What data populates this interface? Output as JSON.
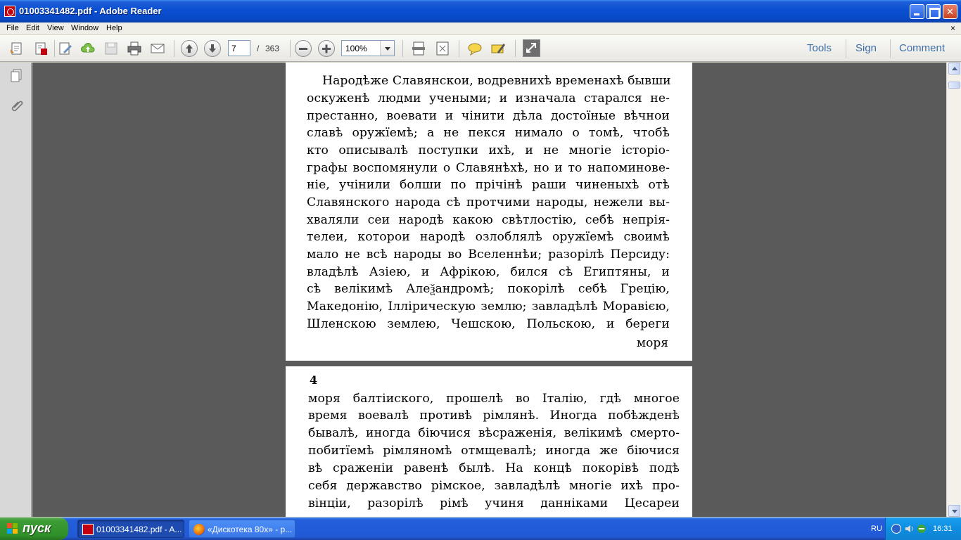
{
  "window": {
    "title": "01003341482.pdf - Adobe Reader"
  },
  "menu": {
    "items": [
      "File",
      "Edit",
      "View",
      "Window",
      "Help"
    ],
    "close_glyph": "×"
  },
  "toolbar": {
    "current_page": "7",
    "page_separator": "/",
    "total_pages": "363",
    "zoom": "100%",
    "right_links": [
      "Tools",
      "Sign",
      "Comment"
    ]
  },
  "document": {
    "page1_lines": [
      "Народѣже Славянскои, водревнихѣ временахѣ бывши",
      "оскуженѣ людми учеными; и изначала старался не-",
      "престанно, воевати и чінити дѣла достоїные вѣчнои",
      "славѣ оружїемѣ; а не пекся нимало о томѣ, чтобѣ",
      "кто описывалѣ поступки ихѣ, и не многіе історіо-",
      "графы воспомянули о Славянѣхѣ, но и то напоминове-",
      "ніе, учінили болши по прічінѣ раши чиненыхѣ отѣ",
      "Славянского народа сѣ протчими народы, нежели вы-",
      "хваляли сеи народѣ какою свѣтлостію, себѣ непрія-",
      "телеи, которои народѣ озлоблялѣ оружїемѣ своимѣ",
      "мало не всѣ народы во Вселеннѣи; разорілѣ Персиду:",
      "владѣлѣ Азіею, и Афрікою, бился сѣ Египтяны, и",
      "сѣ велікимѣ Алеѯандромѣ; покорілѣ себѣ Грецію,",
      "Македонію, Іллірическую землю; завладѣлѣ Моравією,",
      "Шленскою землею, Чешскою, Польскою, и береги"
    ],
    "page1_catchword": "моря",
    "page2_number": "4",
    "page2_lines": [
      "моря балтіиского, прошелѣ во Італію, гдѣ многое",
      "время воевалѣ противѣ рімлянѣ. Иногда побѣжденѣ",
      "бывалѣ, иногда біючися вѣсраженія, велікимѣ смерто-",
      "побитїемѣ рімляномѣ отмщевалѣ; иногда же біючися",
      "вѣ сраженіи равенѣ былѣ. На концѣ покорівѣ подѣ",
      "себя державство рімское, завладѣлѣ многіе ихѣ про-",
      "вінціи, разорілѣ рімѣ учиня данніками Цесареи"
    ]
  },
  "taskbar": {
    "start_label": "пуск",
    "tasks": [
      {
        "label": "01003341482.pdf - A...",
        "icon": "adobe-reader-icon"
      },
      {
        "label": "«Дискотека 80х» - р...",
        "icon": "firefox-icon"
      }
    ],
    "language": "RU",
    "clock": "16:31"
  },
  "colors": {
    "titlebar": "#0a4fd1",
    "doc_background": "#5a5a5a",
    "link_blue": "#3e6ea6",
    "start_green": "#2f8f2a"
  }
}
